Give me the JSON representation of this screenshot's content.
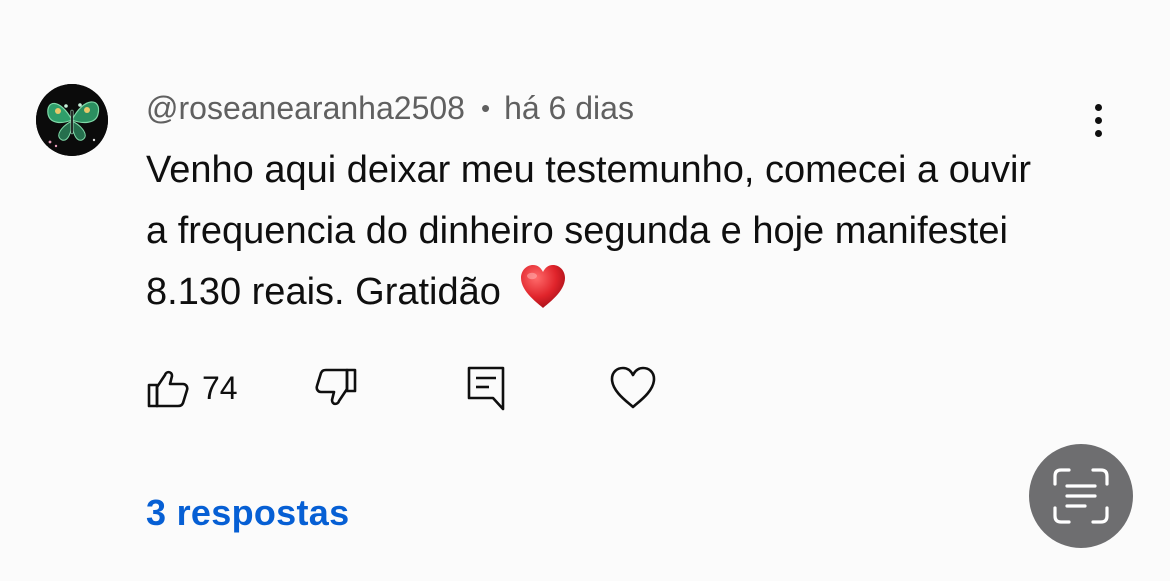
{
  "comment": {
    "author": "@roseanearanha2508",
    "separator": "•",
    "time": "há 6 dias",
    "text": "Venho aqui deixar meu testemunho, comecei a ouvir a frequencia do dinheiro segunda e hoje manifestei 8.130 reais. Gratidão",
    "emoji": "red-heart-emoji",
    "avatar_icon": "butterfly-icon"
  },
  "actions": {
    "like_count": "74",
    "like_icon": "thumbs-up-icon",
    "dislike_icon": "thumbs-down-icon",
    "reply_icon": "comment-icon",
    "heart_icon": "heart-outline-icon"
  },
  "replies": {
    "label": "3 respostas"
  },
  "colors": {
    "link": "#065fd4",
    "text": "#0f0f0f",
    "meta": "#606060",
    "emoji_heart": "#e0242b",
    "lens_button": "#6e6e70"
  },
  "overlay": {
    "icon": "text-scan-icon"
  }
}
